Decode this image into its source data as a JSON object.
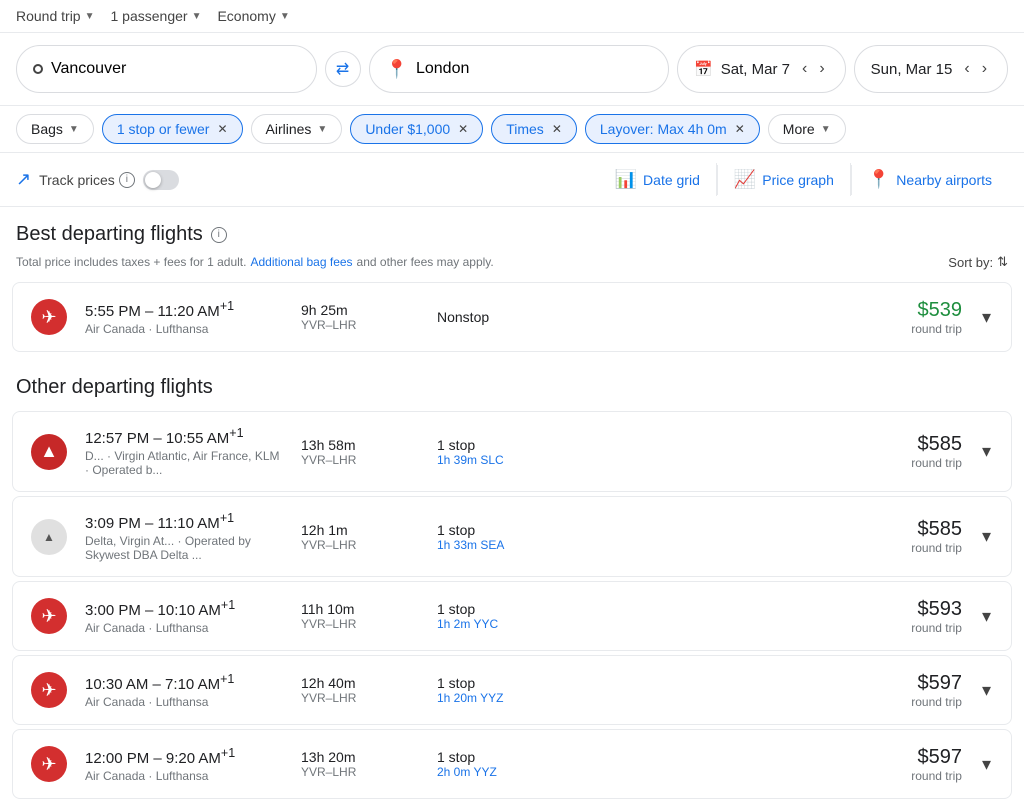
{
  "topbar": {
    "trip_type": "Round trip",
    "passengers": "1 passenger",
    "class": "Economy"
  },
  "search": {
    "origin": "Vancouver",
    "destination": "London",
    "swap_label": "⇄",
    "date_icon": "📅",
    "depart_date": "Sat, Mar 7",
    "return_date": "Sun, Mar 15"
  },
  "filters": {
    "bags_label": "Bags",
    "stop_label": "1 stop or fewer",
    "airlines_label": "Airlines",
    "price_label": "Under $1,000",
    "times_label": "Times",
    "layover_label": "Layover: Max 4h 0m",
    "more_label": "More"
  },
  "track": {
    "label": "Track prices",
    "info": "ℹ",
    "date_grid_label": "Date grid",
    "price_graph_label": "Price graph",
    "nearby_airports_label": "Nearby airports"
  },
  "best_section": {
    "title": "Best departing flights",
    "subtitle_start": "Total price includes taxes + fees for 1 adult.",
    "subtitle_link": "Additional bag fees",
    "subtitle_end": "and other fees may apply.",
    "sort_label": "Sort by:"
  },
  "best_flights": [
    {
      "logo_type": "ac",
      "time_range": "5:55 PM – 11:20 AM",
      "time_suffix": "+1",
      "carrier": "Air Canada · Lufthansa",
      "duration": "9h 25m",
      "route": "YVR–LHR",
      "stops": "Nonstop",
      "stops_detail": "",
      "price": "$539",
      "price_type": "green",
      "price_sub": "round trip"
    }
  ],
  "other_section": {
    "title": "Other departing flights"
  },
  "other_flights": [
    {
      "logo_type": "delta",
      "time_range": "12:57 PM – 10:55 AM",
      "time_suffix": "+1",
      "carrier": "D... · Virgin Atlantic, Air France, KLM · Operated b...",
      "duration": "13h 58m",
      "route": "YVR–LHR",
      "stops": "1 stop",
      "stops_detail": "1h 39m SLC",
      "price": "$585",
      "price_sub": "round trip"
    },
    {
      "logo_type": "delta_gray",
      "time_range": "3:09 PM – 11:10 AM",
      "time_suffix": "+1",
      "carrier": "Delta, Virgin At... · Operated by Skywest DBA Delta ...",
      "duration": "12h 1m",
      "route": "YVR–LHR",
      "stops": "1 stop",
      "stops_detail": "1h 33m SEA",
      "price": "$585",
      "price_sub": "round trip"
    },
    {
      "logo_type": "ac",
      "time_range": "3:00 PM – 10:10 AM",
      "time_suffix": "+1",
      "carrier": "Air Canada · Lufthansa",
      "duration": "11h 10m",
      "route": "YVR–LHR",
      "stops": "1 stop",
      "stops_detail": "1h 2m YYC",
      "price": "$593",
      "price_sub": "round trip"
    },
    {
      "logo_type": "ac",
      "time_range": "10:30 AM – 7:10 AM",
      "time_suffix": "+1",
      "carrier": "Air Canada · Lufthansa",
      "duration": "12h 40m",
      "route": "YVR–LHR",
      "stops": "1 stop",
      "stops_detail": "1h 20m YYZ",
      "price": "$597",
      "price_sub": "round trip"
    },
    {
      "logo_type": "ac",
      "time_range": "12:00 PM – 9:20 AM",
      "time_suffix": "+1",
      "carrier": "Air Canada · Lufthansa",
      "duration": "13h 20m",
      "route": "YVR–LHR",
      "stops": "1 stop",
      "stops_detail": "2h 0m YYZ",
      "price": "$597",
      "price_sub": "round trip"
    }
  ]
}
